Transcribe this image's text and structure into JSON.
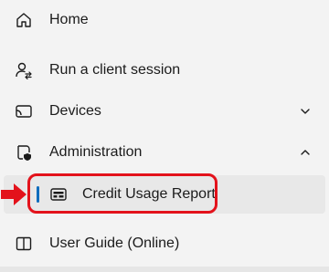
{
  "nav": {
    "items": [
      {
        "label": "Home",
        "icon": "home-icon"
      },
      {
        "label": "Run a client session",
        "icon": "user-switch-icon"
      },
      {
        "label": "Devices",
        "icon": "cast-icon",
        "chevron": "chevron-down-icon"
      },
      {
        "label": "Administration",
        "icon": "shield-document-icon",
        "chevron": "chevron-up-icon",
        "expanded": true
      },
      {
        "label": "User Guide (Online)",
        "icon": "book-icon"
      }
    ],
    "sub_items": [
      {
        "label": "Credit Usage Report",
        "icon": "report-card-icon",
        "selected": true
      }
    ]
  },
  "colors": {
    "accent": "#0f6cbd",
    "highlight": "#e3121b",
    "selected_bg": "#e8e8e8",
    "background": "#f3f3f3"
  }
}
